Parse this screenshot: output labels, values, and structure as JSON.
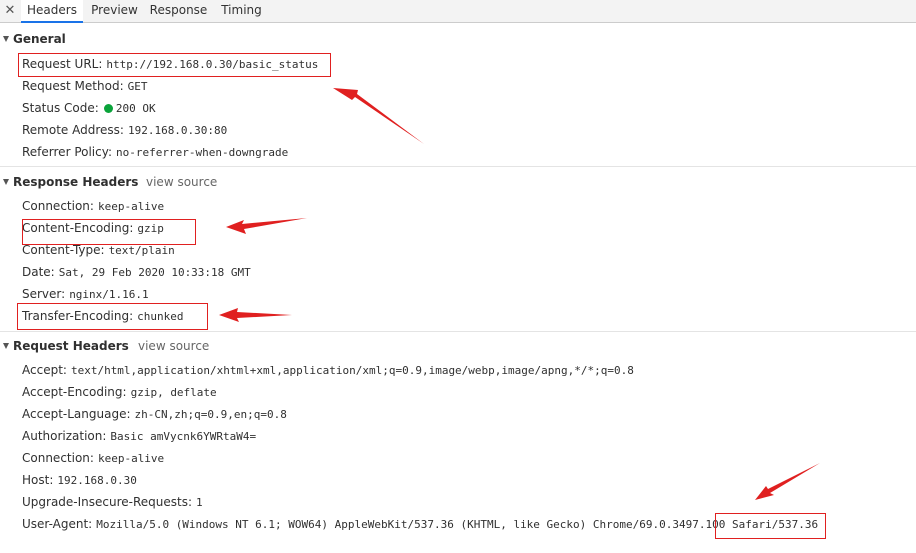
{
  "tabs": {
    "close_glyph": "✕",
    "items": [
      "Headers",
      "Preview",
      "Response",
      "Timing"
    ],
    "active": "Headers"
  },
  "general": {
    "title": "General",
    "rows": [
      {
        "name": "Request URL:",
        "value": "http://192.168.0.30/basic_status"
      },
      {
        "name": "Request Method:",
        "value": "GET"
      },
      {
        "name": "Status Code:",
        "value": "200 OK"
      },
      {
        "name": "Remote Address:",
        "value": "192.168.0.30:80"
      },
      {
        "name": "Referrer Policy:",
        "value": "no-referrer-when-downgrade"
      }
    ]
  },
  "response_headers": {
    "title": "Response Headers",
    "view_source": "view source",
    "rows": [
      {
        "name": "Connection:",
        "value": "keep-alive"
      },
      {
        "name": "Content-Encoding:",
        "value": "gzip"
      },
      {
        "name": "Content-Type:",
        "value": "text/plain"
      },
      {
        "name": "Date:",
        "value": "Sat, 29 Feb 2020 10:33:18 GMT"
      },
      {
        "name": "Server:",
        "value": "nginx/1.16.1"
      },
      {
        "name": "Transfer-Encoding:",
        "value": "chunked"
      }
    ]
  },
  "request_headers": {
    "title": "Request Headers",
    "view_source": "view source",
    "rows": [
      {
        "name": "Accept:",
        "value": "text/html,application/xhtml+xml,application/xml;q=0.9,image/webp,image/apng,*/*;q=0.8"
      },
      {
        "name": "Accept-Encoding:",
        "value": "gzip, deflate"
      },
      {
        "name": "Accept-Language:",
        "value": "zh-CN,zh;q=0.9,en;q=0.8"
      },
      {
        "name": "Authorization:",
        "value": "Basic amVycnk6YWRtaW4="
      },
      {
        "name": "Connection:",
        "value": "keep-alive"
      },
      {
        "name": "Host:",
        "value": "192.168.0.30"
      },
      {
        "name": "Upgrade-Insecure-Requests:",
        "value": "1"
      },
      {
        "name": "User-Agent:",
        "value": "Mozilla/5.0 (Windows NT 6.1; WOW64) AppleWebKit/537.36 (KHTML, like Gecko) Chrome/69.0.3497.100 Safari/537.36"
      }
    ]
  },
  "colors": {
    "annotation": "#e02020",
    "status_ok": "#0aa33a",
    "active_tab_underline": "#1a73e8"
  }
}
